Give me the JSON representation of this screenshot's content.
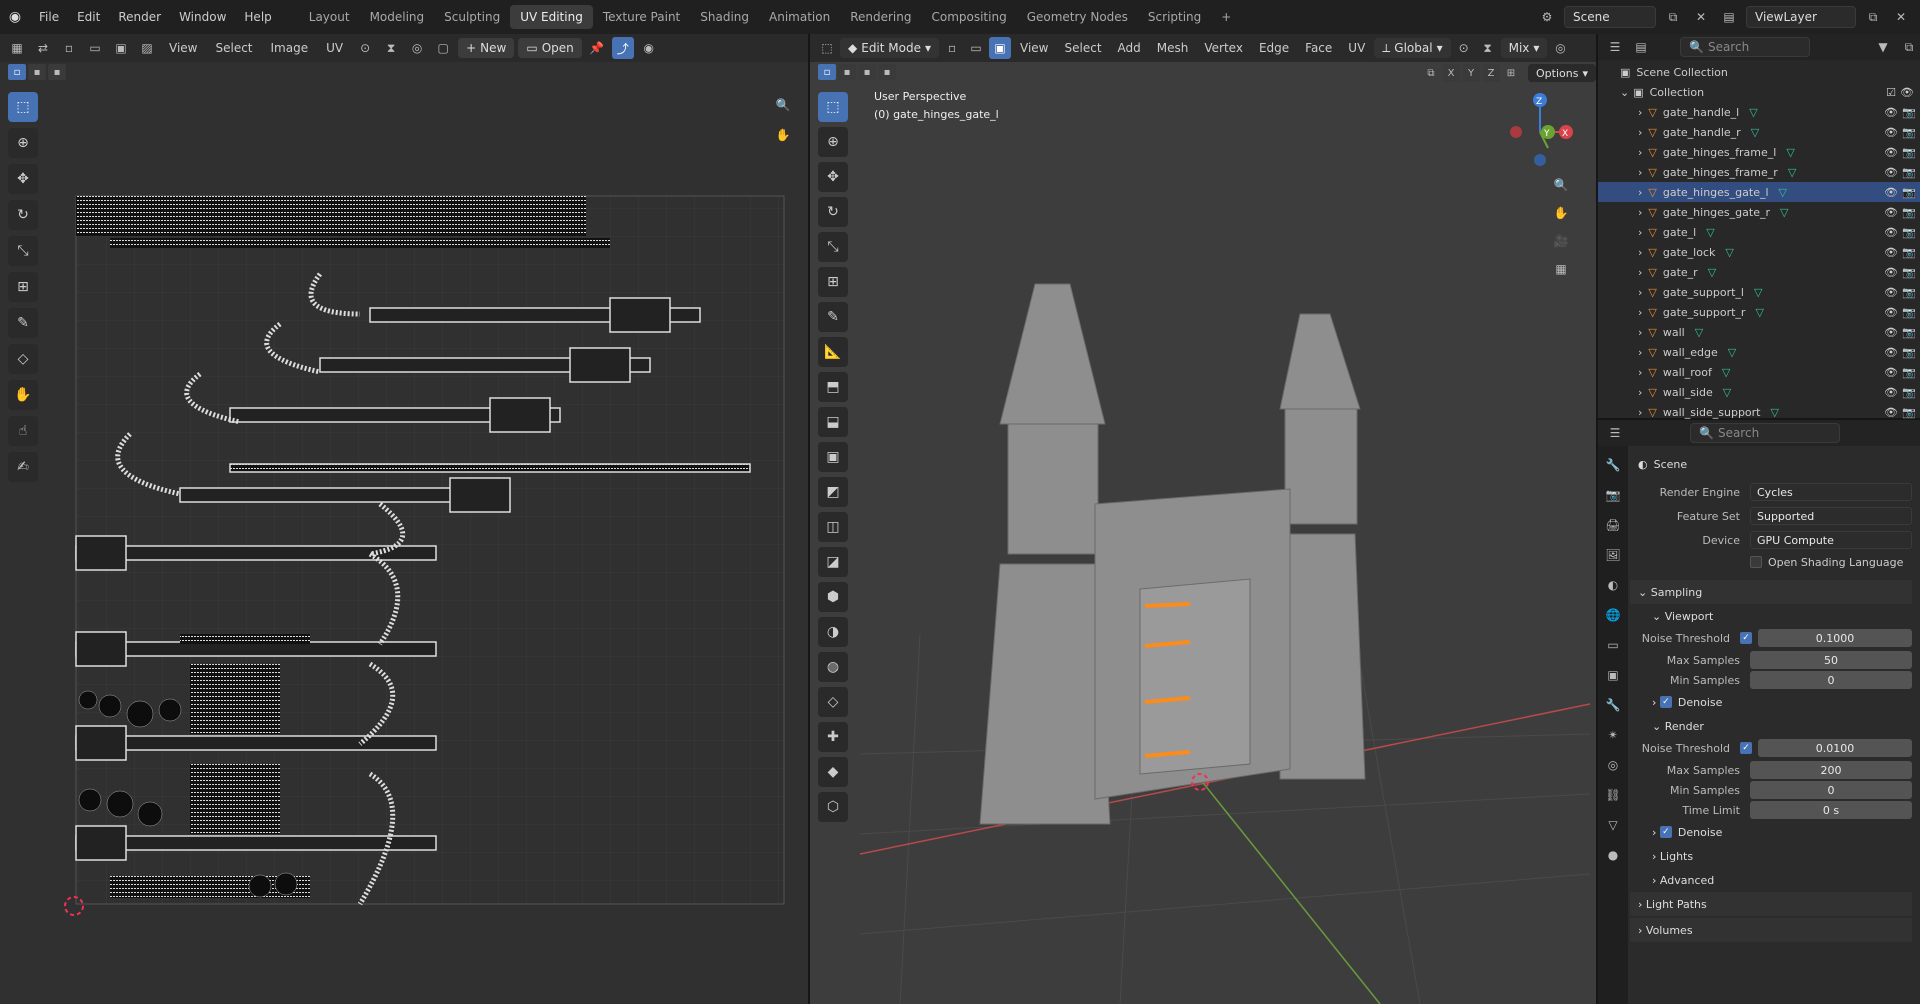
{
  "topbar": {
    "menus": [
      "File",
      "Edit",
      "Render",
      "Window",
      "Help"
    ],
    "workspaces": [
      "Layout",
      "Modeling",
      "Sculpting",
      "UV Editing",
      "Texture Paint",
      "Shading",
      "Animation",
      "Rendering",
      "Compositing",
      "Geometry Nodes",
      "Scripting"
    ],
    "active_workspace": "UV Editing",
    "scene": "Scene",
    "view_layer": "ViewLayer"
  },
  "uv_editor": {
    "menus": [
      "View",
      "Select",
      "Image",
      "UV"
    ],
    "new_label": "New",
    "open_label": "Open"
  },
  "viewport": {
    "mode": "Edit Mode",
    "menus": [
      "View",
      "Select",
      "Add",
      "Mesh",
      "Vertex",
      "Edge",
      "Face",
      "UV"
    ],
    "orientation": "Global",
    "pivot": "Mix",
    "options": "Options",
    "perspective": "User Perspective",
    "object_label": "(0) gate_hinges_gate_l",
    "axes": [
      "X",
      "Y",
      "Z"
    ]
  },
  "outliner": {
    "search": "Search",
    "collection_root": "Scene Collection",
    "collection": "Collection",
    "items": [
      "gate_handle_l",
      "gate_handle_r",
      "gate_hinges_frame_l",
      "gate_hinges_frame_r",
      "gate_hinges_gate_l",
      "gate_hinges_gate_r",
      "gate_l",
      "gate_lock",
      "gate_r",
      "gate_support_l",
      "gate_support_r",
      "wall",
      "wall_edge",
      "wall_roof",
      "wall_side",
      "wall_side_support"
    ],
    "selected": "gate_hinges_gate_l"
  },
  "properties": {
    "search": "Search",
    "context": "Scene",
    "render_engine": {
      "label": "Render Engine",
      "value": "Cycles"
    },
    "feature_set": {
      "label": "Feature Set",
      "value": "Supported"
    },
    "device": {
      "label": "Device",
      "value": "GPU Compute"
    },
    "osl": "Open Shading Language",
    "sampling": "Sampling",
    "viewport": {
      "title": "Viewport",
      "noise_label": "Noise Threshold",
      "noise": "0.1000",
      "max_label": "Max Samples",
      "max": "50",
      "min_label": "Min Samples",
      "min": "0",
      "denoise": "Denoise"
    },
    "render": {
      "title": "Render",
      "noise_label": "Noise Threshold",
      "noise": "0.0100",
      "max_label": "Max Samples",
      "max": "200",
      "min_label": "Min Samples",
      "min": "0",
      "time_label": "Time Limit",
      "time": "0 s",
      "denoise": "Denoise"
    },
    "lights": "Lights",
    "advanced": "Advanced",
    "light_paths": "Light Paths",
    "volumes": "Volumes"
  }
}
